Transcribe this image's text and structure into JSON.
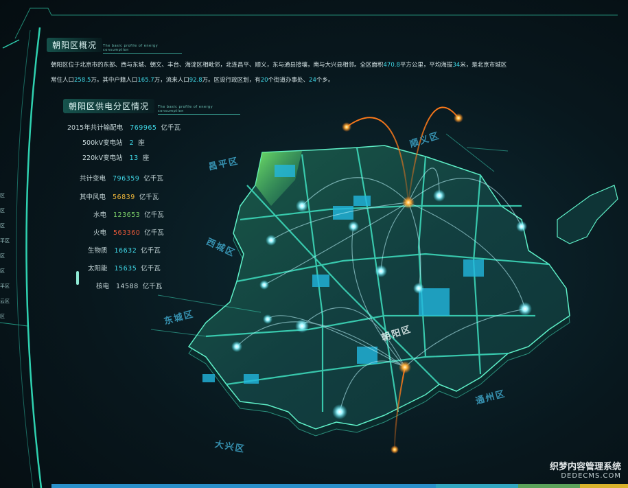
{
  "intro_section": {
    "title": "朝阳区概况",
    "subtitle": "The basic profile of energy consumption",
    "line1": [
      {
        "t": "朝阳区位于北京市的东部、西与东城、朝文、丰台、海淀区相毗邻，北连昌平、顺义，东与通县接壤，南与大兴县相邻。全区面积"
      },
      {
        "t": "470.8",
        "hl": true
      },
      {
        "t": "平方公里，平均海拔"
      },
      {
        "t": "34",
        "hl": true
      },
      {
        "t": "米，是北京市城区"
      }
    ],
    "line2": [
      {
        "t": "常住人口"
      },
      {
        "t": "258.5",
        "hl": true
      },
      {
        "t": "万。其中户籍人口"
      },
      {
        "t": "165.7",
        "hl": true
      },
      {
        "t": "万，流来人口"
      },
      {
        "t": "92.8",
        "hl": true
      },
      {
        "t": "万。区设行政区划，有"
      },
      {
        "t": "20",
        "hl": true
      },
      {
        "t": "个街道办事处、"
      },
      {
        "t": "24",
        "hl": true
      },
      {
        "t": "个乡。"
      }
    ]
  },
  "supply_section": {
    "title": "朝阳区供电分区情况",
    "subtitle": "The basic profile of energy consumption",
    "stats": [
      {
        "label": "2015年共计输配电",
        "value": "769965",
        "unit": "亿千瓦",
        "color": "#3fd7e6"
      },
      {
        "label": "500kV变电站",
        "value": "2",
        "unit": "座",
        "color": "#3fd7e6"
      },
      {
        "label": "220kV变电站",
        "value": "13",
        "unit": "座",
        "color": "#3fd7e6"
      },
      {
        "label": "共计变电",
        "value": "796359",
        "unit": "亿千瓦",
        "color": "#3fd7e6"
      },
      {
        "label": "其中风电",
        "value": "56839",
        "unit": "亿千瓦",
        "color": "#f0b73a"
      },
      {
        "label": "水电",
        "value": "123653",
        "unit": "亿千瓦",
        "color": "#7ed36a"
      },
      {
        "label": "火电",
        "value": "563360",
        "unit": "亿千瓦",
        "color": "#ee5a3a"
      },
      {
        "label": "生物质",
        "value": "16632",
        "unit": "亿千瓦",
        "color": "#3fd7e6"
      },
      {
        "label": "太阳能",
        "value": "15635",
        "unit": "亿千瓦",
        "color": "#3fd7e6"
      },
      {
        "label": "核电",
        "value": "14588",
        "unit": "亿千瓦",
        "color": "#c8d8da"
      }
    ]
  },
  "left_nav": [
    "区",
    "区",
    "区",
    "平区",
    "区",
    "区",
    "平区",
    "云区",
    "区"
  ],
  "districts": [
    {
      "name": "顺义区"
    },
    {
      "name": "昌平区"
    },
    {
      "name": "西城区"
    },
    {
      "name": "东城区"
    },
    {
      "name": "朝阳区"
    },
    {
      "name": "通州区"
    },
    {
      "name": "大兴区"
    }
  ],
  "colors": {
    "accent": "#3fd7e6",
    "map_fill": "#0f3b3a",
    "map_edge": "#5ff0c8",
    "arc_orange": "#ff7a1a",
    "node_glow": "#9ff6ff"
  },
  "watermark": {
    "line1": "织梦内容管理系统",
    "line2": "DEDECMS.COM"
  }
}
